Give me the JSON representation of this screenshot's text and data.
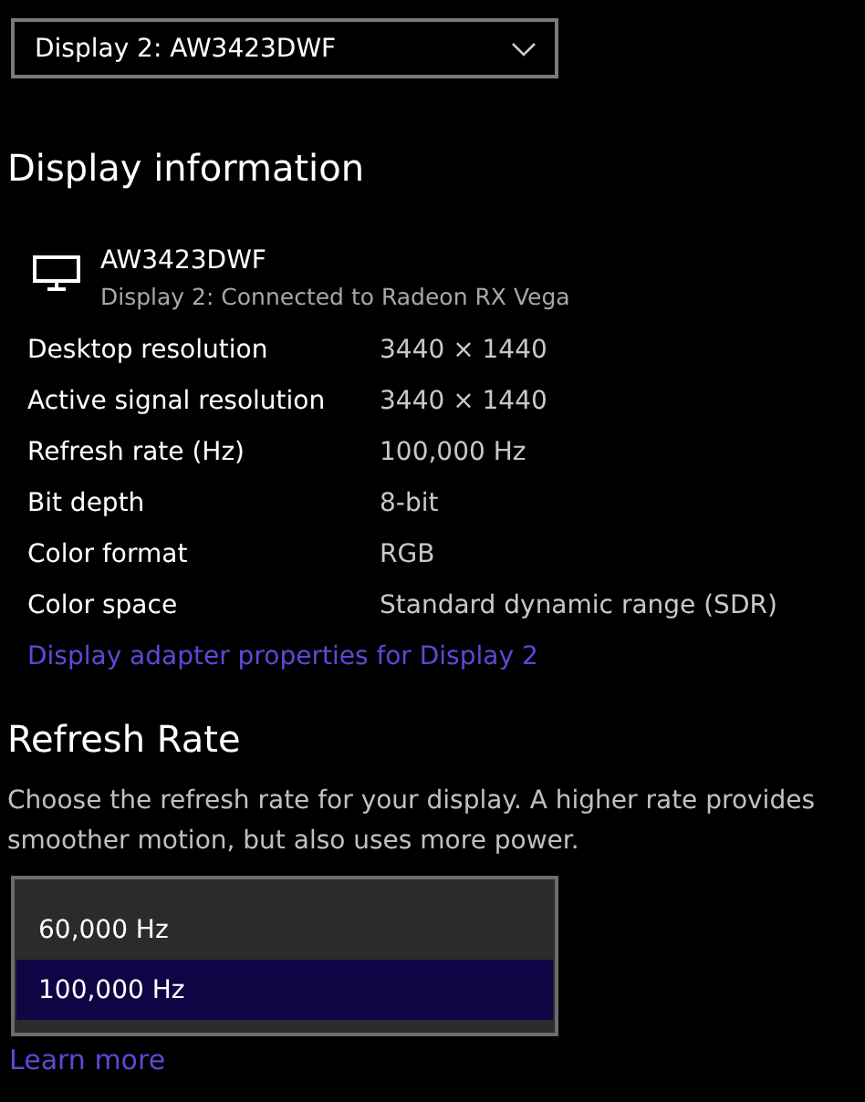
{
  "display_select": {
    "value": "Display 2: AW3423DWF"
  },
  "display_information": {
    "title": "Display information",
    "monitor": {
      "name": "AW3423DWF",
      "connection": "Display 2: Connected to Radeon RX Vega"
    },
    "properties": [
      {
        "label": "Desktop resolution",
        "value": "3440 × 1440"
      },
      {
        "label": "Active signal resolution",
        "value": "3440 × 1440"
      },
      {
        "label": "Refresh rate (Hz)",
        "value": "100,000 Hz"
      },
      {
        "label": "Bit depth",
        "value": "8-bit"
      },
      {
        "label": "Color format",
        "value": "RGB"
      },
      {
        "label": "Color space",
        "value": "Standard dynamic range (SDR)"
      }
    ],
    "link": "Display adapter properties for Display 2"
  },
  "refresh_rate": {
    "title": "Refresh Rate",
    "description": "Choose the refresh rate for your display. A higher rate provides smoother motion, but also uses more power.",
    "options": [
      {
        "label": "60,000 Hz",
        "selected": false
      },
      {
        "label": "100,000 Hz",
        "selected": true
      }
    ],
    "link": "Learn more"
  }
}
